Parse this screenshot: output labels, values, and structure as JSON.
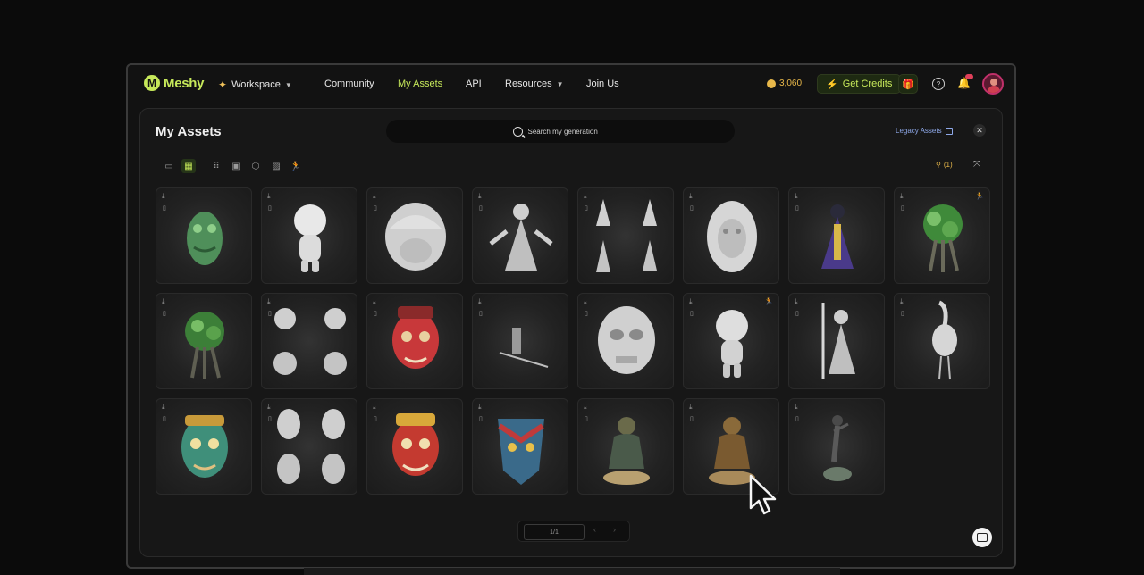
{
  "brand": {
    "name": "Meshy",
    "logo_letter": "M"
  },
  "nav": {
    "workspace": "Workspace",
    "community": "Community",
    "my_assets": "My Assets",
    "api": "API",
    "resources": "Resources",
    "join_us": "Join Us"
  },
  "account": {
    "credits": "3,060",
    "get_credits": "Get Credits"
  },
  "page": {
    "title": "My Assets",
    "search_placeholder": "Search my generation",
    "legacy_assets": "Legacy Assets",
    "filter_count": "(1)"
  },
  "toolbar": {
    "views": [
      "folder-icon",
      "grid-large-icon",
      "grid-small-icon",
      "image-icon",
      "cube-icon",
      "texture-icon",
      "animation-icon"
    ],
    "selected": "grid-large-icon"
  },
  "assets": [
    {
      "name": "green-dragon-mask",
      "rigged": false
    },
    {
      "name": "white-chibi-girl",
      "rigged": false
    },
    {
      "name": "white-bob-hair-head",
      "rigged": false
    },
    {
      "name": "white-robed-woman",
      "rigged": false
    },
    {
      "name": "white-figure-variations",
      "rigged": false
    },
    {
      "name": "white-lion-head",
      "rigged": false
    },
    {
      "name": "purple-robed-sorcerer",
      "rigged": false
    },
    {
      "name": "green-tree-creature",
      "rigged": true
    },
    {
      "name": "green-tree-creature-2",
      "rigged": false
    },
    {
      "name": "white-tree-creature-variations",
      "rigged": false
    },
    {
      "name": "red-demon-mask",
      "rigged": false
    },
    {
      "name": "flat-panel-object",
      "rigged": false
    },
    {
      "name": "white-skull-mask",
      "rigged": false
    },
    {
      "name": "white-chibi-boy",
      "rigged": true
    },
    {
      "name": "white-warrior-statue",
      "rigged": false
    },
    {
      "name": "white-crane-bird",
      "rigged": false
    },
    {
      "name": "green-demon-mask",
      "rigged": false
    },
    {
      "name": "white-demon-mask-variations",
      "rigged": false
    },
    {
      "name": "red-demon-mask-2",
      "rigged": false
    },
    {
      "name": "colorful-tribal-mask",
      "rigged": false
    },
    {
      "name": "bronze-buddha-statue",
      "rigged": false
    },
    {
      "name": "bronze-buddha-statue-2",
      "rigged": false
    },
    {
      "name": "dark-dancer-statue",
      "rigged": false
    }
  ],
  "pagination": {
    "label": "1/1"
  },
  "colors": {
    "accent": "#c6e85a",
    "coin": "#e8b84a",
    "link": "#8ea8e8"
  }
}
